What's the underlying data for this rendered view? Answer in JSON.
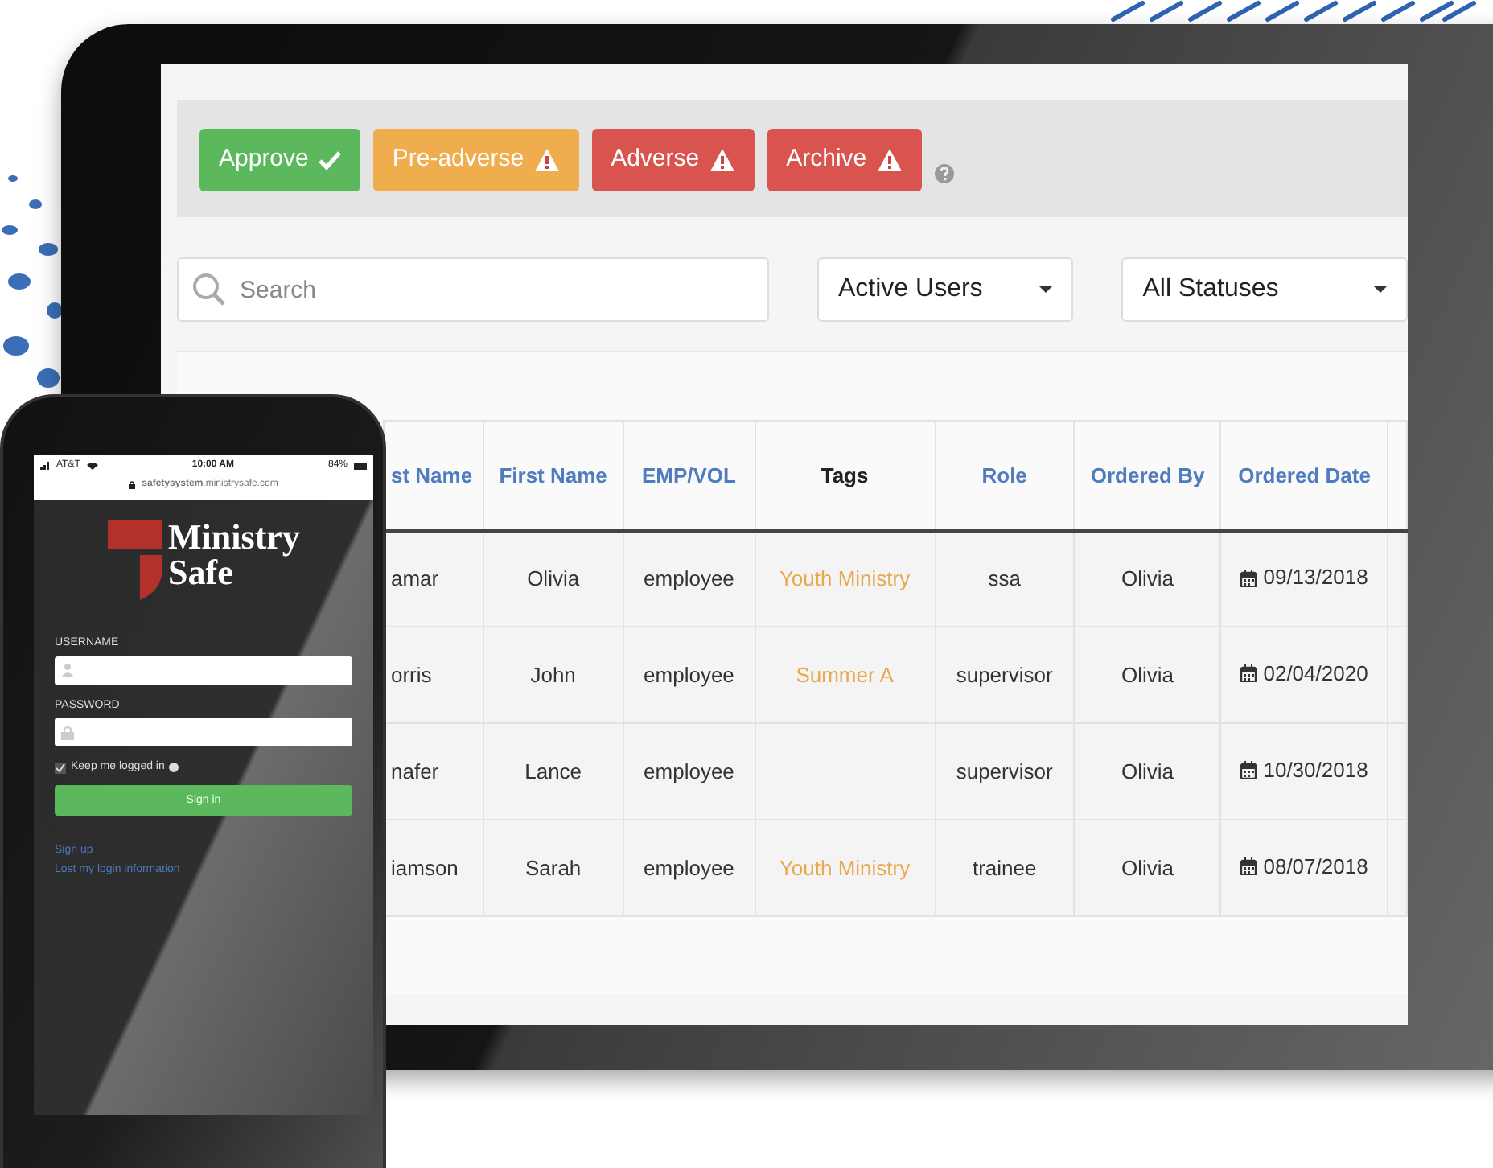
{
  "tablet": {
    "actions": [
      {
        "label": "Approve",
        "kind": "approve"
      },
      {
        "label": "Pre-adverse",
        "kind": "warning"
      },
      {
        "label": "Adverse",
        "kind": "danger"
      },
      {
        "label": "Archive",
        "kind": "danger"
      }
    ],
    "search": {
      "placeholder": "Search"
    },
    "filters": [
      "Active Users",
      "All Statuses"
    ],
    "table": {
      "columns": [
        {
          "label": "st Name",
          "sortable": true,
          "kind": "text"
        },
        {
          "label": "First Name",
          "sortable": true,
          "kind": "text"
        },
        {
          "label": "EMP/VOL",
          "sortable": true,
          "kind": "text"
        },
        {
          "label": "Tags",
          "sortable": false,
          "kind": "tag"
        },
        {
          "label": "Role",
          "sortable": true,
          "kind": "text"
        },
        {
          "label": "Ordered By",
          "sortable": true,
          "kind": "text"
        },
        {
          "label": "Ordered Date",
          "sortable": true,
          "kind": "date"
        }
      ],
      "rows": [
        [
          "amar",
          "Olivia",
          "employee",
          "Youth Ministry",
          "ssa",
          "Olivia",
          "09/13/2018"
        ],
        [
          "orris",
          "John",
          "employee",
          "Summer A",
          "supervisor",
          "Olivia",
          "02/04/2020"
        ],
        [
          "nafer",
          "Lance",
          "employee",
          "",
          "supervisor",
          "Olivia",
          "10/30/2018"
        ],
        [
          "iamson",
          "Sarah",
          "employee",
          "Youth Ministry",
          "trainee",
          "Olivia",
          "08/07/2018"
        ]
      ]
    }
  },
  "phone": {
    "carrier": "AT&T",
    "time": "10:00 AM",
    "battery": "84%",
    "url": "**safetysystem**.ministrysafe.com",
    "logo_lines": [
      "Ministry",
      "Safe"
    ],
    "fields": [
      {
        "label": "USERNAME",
        "kind": "user"
      },
      {
        "label": "PASSWORD",
        "kind": "lock"
      }
    ],
    "remember": {
      "label": "Keep me logged in",
      "checked": true
    },
    "button": "Sign in",
    "links": [
      "Sign up",
      "Lost my login information"
    ]
  }
}
